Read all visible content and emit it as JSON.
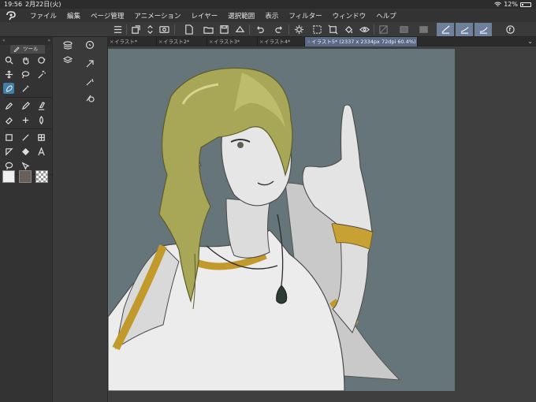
{
  "status": {
    "time": "19:56",
    "date": "2月22日(火)",
    "battery": "12%"
  },
  "menu": [
    "ファイル",
    "編集",
    "ページ管理",
    "アニメーション",
    "レイヤー",
    "選択範囲",
    "表示",
    "フィルター",
    "ウィンドウ",
    "ヘルプ"
  ],
  "toolpanel": {
    "tab_label": "ツール",
    "header": "« »"
  },
  "tabs": [
    {
      "label": "イラスト*"
    },
    {
      "label": "イラスト2*"
    },
    {
      "label": "イラスト3*"
    },
    {
      "label": "イラスト4*"
    },
    {
      "label": "イラスト5* (2337 x 2334px 72dpi 60.4%)"
    }
  ],
  "colors": {
    "main": "#f0f0f0",
    "sub": "#6b5e58",
    "accent": "#5a6a86",
    "canvas_bg": "#657579"
  }
}
